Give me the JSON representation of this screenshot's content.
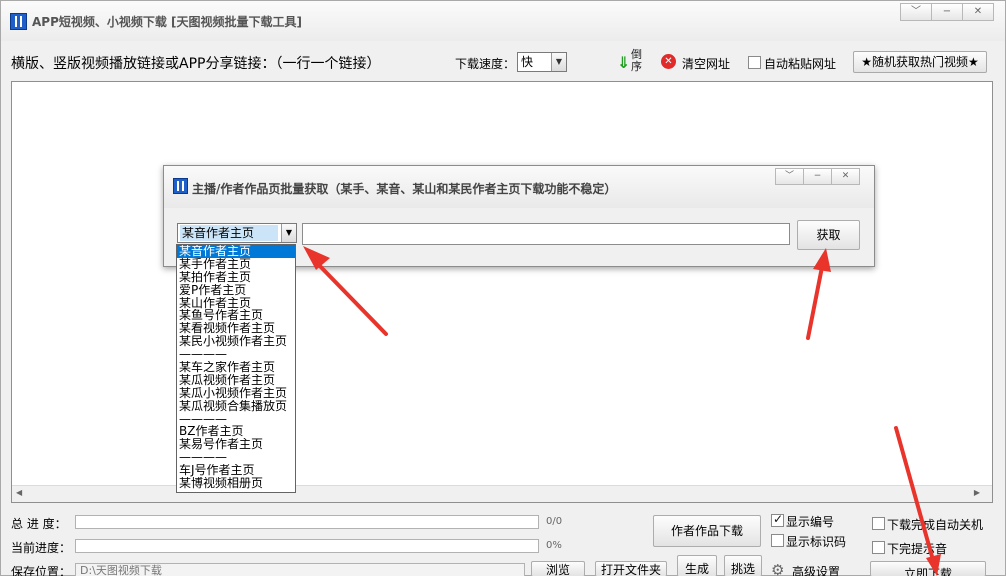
{
  "window": {
    "title": "APP短视频、小视频下载 [天图视频批量下载工具]",
    "controls": [
      "﹀",
      "−",
      "✕"
    ]
  },
  "toolbar": {
    "url_label": "横版、竖版视频播放链接或APP分享链接：（一行一个链接）",
    "speed_label": "下载速度：",
    "speed_value": "快",
    "reverse_label": "倒序",
    "clear_label": "清空网址",
    "auto_paste_label": "自动粘贴网址",
    "hot_button": "★随机获取热门视频★"
  },
  "dialog": {
    "title": "主播/作者作品页批量获取（某手、某音、某山和某民作者主页下载功能不稳定）",
    "combo_value": "某音作者主页",
    "input_value": "",
    "get_button": "获取",
    "options": [
      "某音作者主页",
      "某手作者主页",
      "某拍作者主页",
      "爱P作者主页",
      "某山作者主页",
      "某鱼号作者主页",
      "某看视频作者主页",
      "某民小视频作者主页",
      "————",
      "某车之家作者主页",
      "某瓜视频作者主页",
      "某瓜小视频作者主页",
      "某瓜视频合集播放页",
      "————",
      "BZ作者主页",
      "某易号作者主页",
      "————",
      "车J号作者主页",
      "某博视频相册页"
    ],
    "selected_index": 0
  },
  "progress": {
    "total_label": "总 进 度：",
    "total_value": "0/0",
    "total_fraction": 0,
    "current_label": "当前进度：",
    "current_value": "0%",
    "current_fraction": 0,
    "save_label": "保存位置：",
    "save_path": "D:\\天图视频下载"
  },
  "buttons": {
    "author_download": "作者作品下载",
    "show_number": "显示编号",
    "show_id": "显示标识码",
    "shutdown": "下载完成自动关机",
    "sound": "下完提示音",
    "browse": "浏览",
    "open_folder": "打开文件夹",
    "generate": "生成",
    "pick": "挑选",
    "advanced": "高级设置",
    "download_now": "立即下载"
  },
  "checks": {
    "show_number": true,
    "show_id": false,
    "shutdown": false,
    "sound": false,
    "auto_paste": false
  },
  "colors": {
    "annotation_arrow": "#e8342b",
    "selected_item": "#0078d7"
  }
}
